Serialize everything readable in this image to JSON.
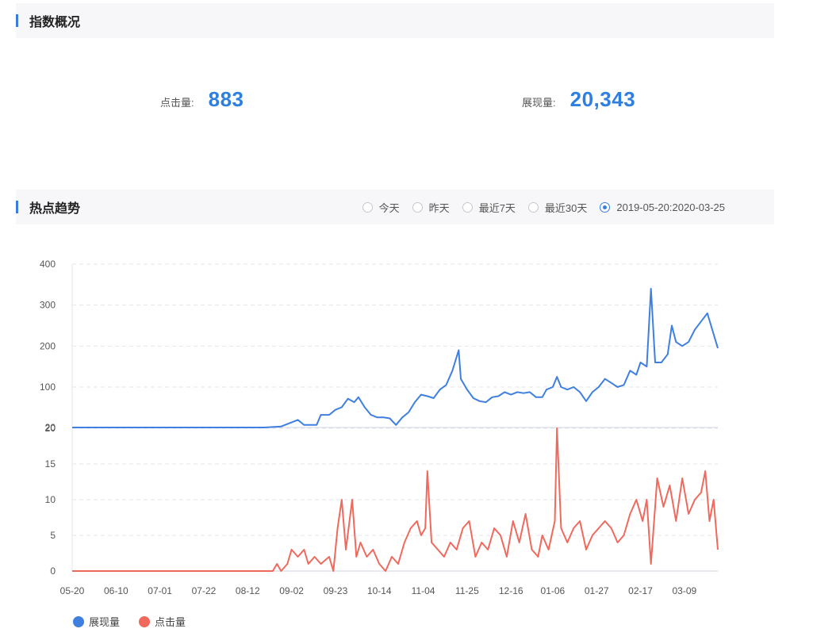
{
  "overview": {
    "title": "指数概况",
    "clicks_label": "点击量:",
    "clicks_value": "883",
    "views_label": "展现量:",
    "views_value": "20,343"
  },
  "trend": {
    "title": "热点趋势",
    "range_options": [
      "今天",
      "昨天",
      "最近7天",
      "最近30天",
      "2019-05-20:2020-03-25"
    ],
    "selected_range": "2019-05-20:2020-03-25"
  },
  "colors": {
    "views": "#3f7fe0",
    "clicks": "#f0695d",
    "accent": "#3b7ddd"
  },
  "chart_data": [
    {
      "type": "line",
      "series": [
        {
          "name": "展现量",
          "color": "#3f7fe0"
        }
      ],
      "y_ticks": [
        "20",
        "100",
        "200",
        "300",
        "400"
      ],
      "ylim": [
        20,
        400
      ],
      "x": [
        "05-20",
        "06-10",
        "07-01",
        "07-22",
        "08-12",
        "09-02",
        "09-23",
        "10-14",
        "11-04",
        "11-25",
        "12-16",
        "01-06",
        "01-27",
        "02-17",
        "03-09"
      ],
      "points": [
        [
          "05-20",
          20
        ],
        [
          "08-01",
          20
        ],
        [
          "08-20",
          20
        ],
        [
          "08-28",
          22
        ],
        [
          "09-02",
          30
        ],
        [
          "09-05",
          35
        ],
        [
          "09-08",
          25
        ],
        [
          "09-14",
          25
        ],
        [
          "09-16",
          45
        ],
        [
          "09-20",
          45
        ],
        [
          "09-23",
          55
        ],
        [
          "09-26",
          60
        ],
        [
          "09-29",
          77
        ],
        [
          "10-02",
          70
        ],
        [
          "10-04",
          80
        ],
        [
          "10-07",
          60
        ],
        [
          "10-10",
          45
        ],
        [
          "10-13",
          40
        ],
        [
          "10-16",
          40
        ],
        [
          "10-19",
          38
        ],
        [
          "10-22",
          25
        ],
        [
          "10-25",
          40
        ],
        [
          "10-28",
          50
        ],
        [
          "10-31",
          70
        ],
        [
          "11-03",
          85
        ],
        [
          "11-06",
          82
        ],
        [
          "11-09",
          78
        ],
        [
          "11-12",
          95
        ],
        [
          "11-15",
          105
        ],
        [
          "11-18",
          140
        ],
        [
          "11-21",
          190
        ],
        [
          "11-22",
          120
        ],
        [
          "11-25",
          95
        ],
        [
          "11-28",
          78
        ],
        [
          "12-01",
          72
        ],
        [
          "12-04",
          70
        ],
        [
          "12-07",
          80
        ],
        [
          "12-10",
          82
        ],
        [
          "12-13",
          90
        ],
        [
          "12-16",
          85
        ],
        [
          "12-19",
          90
        ],
        [
          "12-22",
          88
        ],
        [
          "12-25",
          90
        ],
        [
          "12-28",
          80
        ],
        [
          "12-31",
          80
        ],
        [
          "01-03",
          95
        ],
        [
          "01-06",
          100
        ],
        [
          "01-08",
          125
        ],
        [
          "01-10",
          100
        ],
        [
          "01-13",
          95
        ],
        [
          "01-16",
          100
        ],
        [
          "01-19",
          90
        ],
        [
          "01-22",
          72
        ],
        [
          "01-25",
          90
        ],
        [
          "01-28",
          100
        ],
        [
          "01-31",
          120
        ],
        [
          "02-03",
          110
        ],
        [
          "02-06",
          100
        ],
        [
          "02-09",
          105
        ],
        [
          "02-12",
          140
        ],
        [
          "02-15",
          130
        ],
        [
          "02-17",
          160
        ],
        [
          "02-20",
          150
        ],
        [
          "02-22",
          340
        ],
        [
          "02-24",
          160
        ],
        [
          "02-27",
          160
        ],
        [
          "03-01",
          180
        ],
        [
          "03-03",
          250
        ],
        [
          "03-05",
          210
        ],
        [
          "03-08",
          200
        ],
        [
          "03-11",
          210
        ],
        [
          "03-14",
          240
        ],
        [
          "03-17",
          260
        ],
        [
          "03-20",
          280
        ],
        [
          "03-25",
          195
        ]
      ]
    },
    {
      "type": "line",
      "series": [
        {
          "name": "点击量",
          "color": "#f0695d"
        }
      ],
      "y_ticks": [
        "0",
        "5",
        "10",
        "15",
        "20"
      ],
      "ylim": [
        0,
        20
      ],
      "x": [
        "05-20",
        "06-10",
        "07-01",
        "07-22",
        "08-12",
        "09-02",
        "09-23",
        "10-14",
        "11-04",
        "11-25",
        "12-16",
        "01-06",
        "01-27",
        "02-17",
        "03-09"
      ],
      "points": [
        [
          "05-20",
          0
        ],
        [
          "08-24",
          0
        ],
        [
          "08-26",
          1
        ],
        [
          "08-28",
          0
        ],
        [
          "08-31",
          1
        ],
        [
          "09-02",
          3
        ],
        [
          "09-05",
          2
        ],
        [
          "09-08",
          3
        ],
        [
          "09-10",
          1
        ],
        [
          "09-13",
          2
        ],
        [
          "09-16",
          1
        ],
        [
          "09-20",
          2
        ],
        [
          "09-22",
          0
        ],
        [
          "09-24",
          6
        ],
        [
          "09-26",
          10
        ],
        [
          "09-28",
          3
        ],
        [
          "10-01",
          10
        ],
        [
          "10-03",
          2
        ],
        [
          "10-05",
          4
        ],
        [
          "10-08",
          2
        ],
        [
          "10-11",
          3
        ],
        [
          "10-14",
          1
        ],
        [
          "10-17",
          0
        ],
        [
          "10-20",
          2
        ],
        [
          "10-23",
          1
        ],
        [
          "10-26",
          4
        ],
        [
          "10-29",
          6
        ],
        [
          "11-01",
          7
        ],
        [
          "11-03",
          5
        ],
        [
          "11-05",
          6
        ],
        [
          "11-06",
          14
        ],
        [
          "11-08",
          4
        ],
        [
          "11-11",
          3
        ],
        [
          "11-14",
          2
        ],
        [
          "11-17",
          4
        ],
        [
          "11-20",
          3
        ],
        [
          "11-23",
          6
        ],
        [
          "11-26",
          7
        ],
        [
          "11-29",
          2
        ],
        [
          "12-02",
          4
        ],
        [
          "12-05",
          3
        ],
        [
          "12-08",
          6
        ],
        [
          "12-11",
          5
        ],
        [
          "12-14",
          2
        ],
        [
          "12-17",
          7
        ],
        [
          "12-20",
          4
        ],
        [
          "12-23",
          8
        ],
        [
          "12-26",
          3
        ],
        [
          "12-29",
          2
        ],
        [
          "01-01",
          5
        ],
        [
          "01-04",
          3
        ],
        [
          "01-07",
          7
        ],
        [
          "01-08",
          20
        ],
        [
          "01-10",
          6
        ],
        [
          "01-13",
          4
        ],
        [
          "01-16",
          6
        ],
        [
          "01-19",
          7
        ],
        [
          "01-22",
          3
        ],
        [
          "01-25",
          5
        ],
        [
          "01-28",
          6
        ],
        [
          "01-31",
          7
        ],
        [
          "02-03",
          6
        ],
        [
          "02-06",
          4
        ],
        [
          "02-09",
          5
        ],
        [
          "02-12",
          8
        ],
        [
          "02-15",
          10
        ],
        [
          "02-18",
          7
        ],
        [
          "02-20",
          10
        ],
        [
          "02-22",
          1
        ],
        [
          "02-25",
          13
        ],
        [
          "02-28",
          9
        ],
        [
          "03-02",
          12
        ],
        [
          "03-05",
          7
        ],
        [
          "03-08",
          13
        ],
        [
          "03-11",
          8
        ],
        [
          "03-14",
          10
        ],
        [
          "03-17",
          11
        ],
        [
          "03-19",
          14
        ],
        [
          "03-21",
          7
        ],
        [
          "03-23",
          10
        ],
        [
          "03-25",
          3
        ]
      ]
    }
  ],
  "legend": {
    "views": "展现量",
    "clicks": "点击量"
  }
}
